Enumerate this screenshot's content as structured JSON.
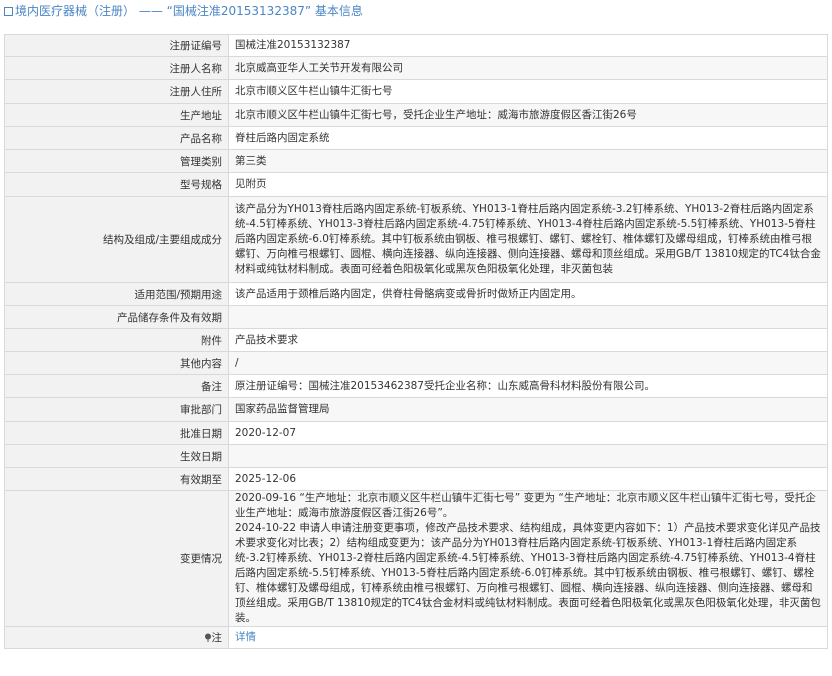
{
  "header": {
    "prefix": "境内医疗器械（注册）",
    "sep": " —— ",
    "title": "“国械注准20153132387” 基本信息"
  },
  "rows": [
    {
      "label": "注册证编号",
      "value": "国械注准20153132387"
    },
    {
      "label": "注册人名称",
      "value": "北京威高亚华人工关节开发有限公司"
    },
    {
      "label": "注册人住所",
      "value": "北京市顺义区牛栏山镇牛汇街七号"
    },
    {
      "label": "生产地址",
      "value": "北京市顺义区牛栏山镇牛汇街七号，受托企业生产地址：威海市旅游度假区香江街26号"
    },
    {
      "label": "产品名称",
      "value": "脊柱后路内固定系统"
    },
    {
      "label": "管理类别",
      "value": "第三类"
    },
    {
      "label": "型号规格",
      "value": "见附页"
    },
    {
      "label": "结构及组成/主要组成成分",
      "value": "该产品分为YH013脊柱后路内固定系统-钉板系统、YH013-1脊柱后路内固定系统-3.2钉棒系统、YH013-2脊柱后路内固定系统-4.5钉棒系统、YH013-3脊柱后路内固定系统-4.75钉棒系统、YH013-4脊柱后路内固定系统-5.5钉棒系统、YH013-5脊柱后路内固定系统-6.0钉棒系统。其中钉板系统由钢板、椎弓根螺钉、螺钉、螺栓钉、椎体螺钉及螺母组成，钉棒系统由椎弓根螺钉、万向椎弓根螺钉、圆棍、横向连接器、纵向连接器、侧向连接器、螺母和顶丝组成。采用GB/T 13810规定的TC4钛合金材料或纯钛材料制成。表面可经着色阳极氧化或黑灰色阳极氧化处理，非灭菌包装"
    },
    {
      "label": "适用范围/预期用途",
      "value": "该产品适用于颈椎后路内固定，供脊柱骨骼病变或骨折时做矫正内固定用。"
    },
    {
      "label": "产品储存条件及有效期",
      "value": ""
    },
    {
      "label": "附件",
      "value": "产品技术要求"
    },
    {
      "label": "其他内容",
      "value": "/"
    },
    {
      "label": "备注",
      "value": "原注册证编号：国械注准20153462387受托企业名称：山东威高骨科材料股份有限公司。"
    },
    {
      "label": "审批部门",
      "value": "国家药品监督管理局"
    },
    {
      "label": "批准日期",
      "value": "2020-12-07"
    },
    {
      "label": "生效日期",
      "value": ""
    },
    {
      "label": "有效期至",
      "value": "2025-12-06"
    },
    {
      "label": "变更情况",
      "value": "2020-09-16 “生产地址：北京市顺义区牛栏山镇牛汇街七号” 变更为 “生产地址：北京市顺义区牛栏山镇牛汇街七号，受托企业生产地址：威海市旅游度假区香江街26号”。\n2024-10-22 申请人申请注册变更事项，修改产品技术要求、结构组成，具体变更内容如下：1）产品技术要求变化详见产品技术要求变化对比表；2）结构组成变更为：该产品分为YH013脊柱后路内固定系统-钉板系统、YH013-1脊柱后路内固定系统-3.2钉棒系统、YH013-2脊柱后路内固定系统-4.5钉棒系统、YH013-3脊柱后路内固定系统-4.75钉棒系统、YH013-4脊柱后路内固定系统-5.5钉棒系统、YH013-5脊柱后路内固定系统-6.0钉棒系统。其中钉板系统由钢板、椎弓根螺钉、螺钉、螺栓钉、椎体螺钉及螺母组成，钉棒系统由椎弓根螺钉、万向椎弓根螺钉、圆棍、横向连接器、纵向连接器、侧向连接器、螺母和顶丝组成。采用GB/T 13810规定的TC4钛合金材料或纯钛材料制成。表面可经着色阳极氧化或黑灰色阳极氧化处理，非灭菌包装。"
    }
  ],
  "footer": {
    "label": "注",
    "link": "详情"
  },
  "colors": {
    "accent": "#4a86c5",
    "label_bg": "#f2f2f2",
    "border": "#d9d9d9"
  }
}
